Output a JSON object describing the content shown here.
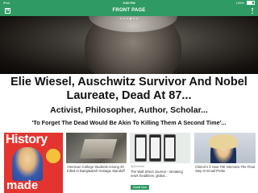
{
  "status_bar": {
    "left": "iPad",
    "time": "9:00 PM",
    "battery": "100%"
  },
  "nav": {
    "logo_letter": "H",
    "title": "FRONT PAGE"
  },
  "hero": {
    "slide_count": 6,
    "active_slide": 3
  },
  "article": {
    "headline_line1": "Elie Wiesel, Auschwitz Survivor And Nobel",
    "headline_line2": "Laureate, Dead At 87...",
    "subhead": "Activist, Philosopher, Author, Scholar...",
    "quote": "'To Forget The Dead Would Be Akin To Killing Them A Second Time'..."
  },
  "cards": [
    {
      "type": "magazine",
      "title": "History",
      "bottom_word": "made"
    },
    {
      "caption": "American College Students Among 20 Killed In Bangladesh Hostage Standoff"
    },
    {
      "sponsor": "Sponsored",
      "caption": "The Wall Street Journal – Breaking news headlines, global...",
      "install_label": "Install Now"
    },
    {
      "caption": "Clinton's 3 Hour FBI Interview The Final Step In Email Probe"
    }
  ]
}
